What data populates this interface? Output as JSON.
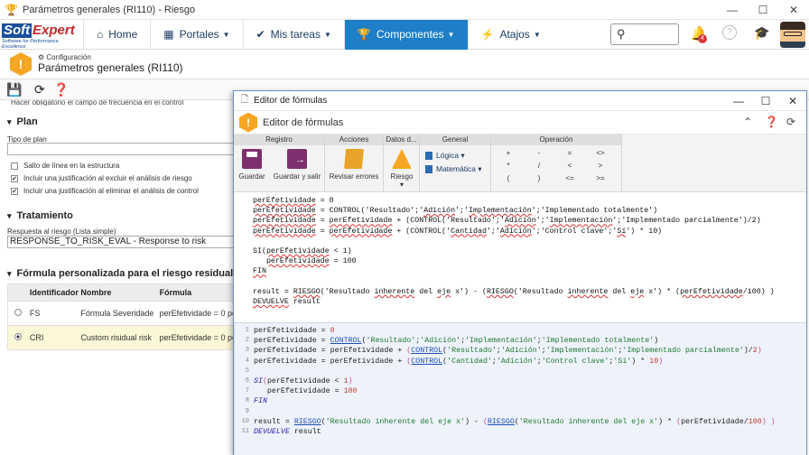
{
  "window": {
    "title": "Parámetros generales (RI110) - Riesgo",
    "min": "—",
    "max": "☐",
    "close": "✕"
  },
  "nav": {
    "logo_soft": "Soft",
    "logo_expert": "Expert",
    "logo_tagline": "Software for Performance Excellence",
    "items": [
      {
        "label": "Home",
        "icon": "home-icon"
      },
      {
        "label": "Portales",
        "icon": "portal-icon"
      },
      {
        "label": "Mis tareas",
        "icon": "check-icon"
      },
      {
        "label": "Componentes",
        "icon": "trophy-icon"
      },
      {
        "label": "Atajos",
        "icon": "bolt-icon"
      }
    ],
    "notification_count": "4"
  },
  "page": {
    "subtitle": "Configuración",
    "title": "Parámetros generales (RI110)"
  },
  "background": {
    "cut_text": "Hacer obligatorio el campo de frecuencia en el control",
    "section_plan": "Plan",
    "label_tipo_plan": "Tipo de plan",
    "checks": [
      {
        "label": "Salto de línea en la estructura",
        "checked": false
      },
      {
        "label": "Incluir una justificación al excluir el análisis de riesgo",
        "checked": true
      },
      {
        "label": "Incluir una justificación al eliminar el análisis de control",
        "checked": true
      }
    ],
    "section_tratamiento": "Tratamiento",
    "label_respuesta": "Respuesta al riesgo (Lista simple)",
    "respuesta_value": "RESPONSE_TO_RISK_EVAL - Response to risk",
    "section_formula": "Fórmula personalizada para el riesgo residual",
    "table": {
      "headers": [
        "Identificador",
        "Nombre",
        "Fórmula"
      ],
      "rows": [
        {
          "id": "FS",
          "name": "Fórmula Severidade",
          "formula": "perEfetividade = 0 pe",
          "selected": false
        },
        {
          "id": "CRI",
          "name": "Custom risidual risk",
          "formula": "perEfetividade = 0 pe",
          "selected": true
        }
      ]
    }
  },
  "dialog": {
    "window_title": "Editor de fórmulas",
    "header_title": "Editor de fórmulas",
    "ribbon": {
      "groups": [
        "Registro",
        "Acciones",
        "Datos d...",
        "General",
        "Operación"
      ],
      "guardar": "Guardar",
      "guardar_salir": "Guardar y salir",
      "revisar": "Revisar errores",
      "riesgo": "Riesgo",
      "logica": "Lógica",
      "matematica": "Matemática",
      "operators": [
        "+",
        "-",
        "=",
        "<>",
        "*",
        "/",
        "<",
        ">",
        "(",
        ")",
        "<=",
        ">="
      ]
    },
    "line_numbers": "1\n2\n3\n4\n5\n6\n7\n8\n9\n10\n11"
  }
}
